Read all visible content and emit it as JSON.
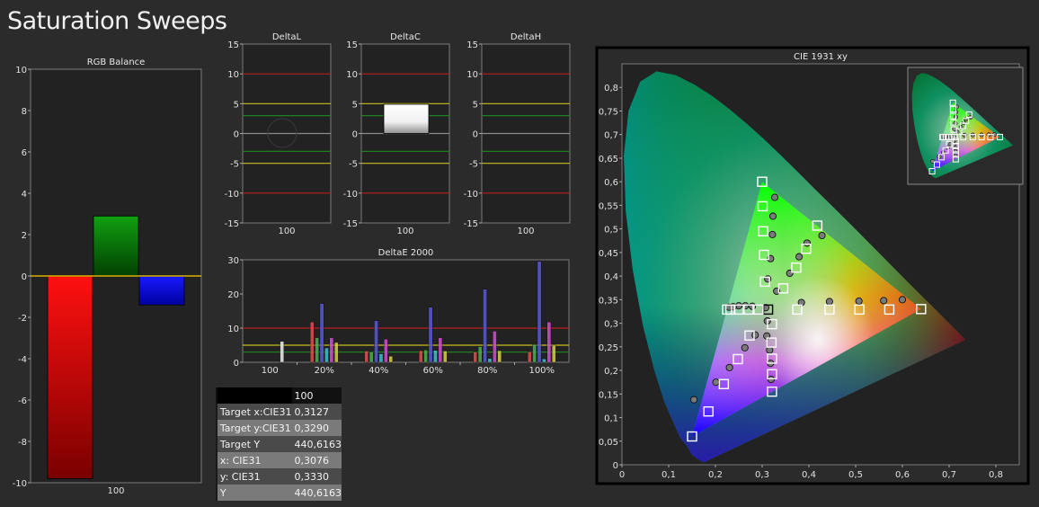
{
  "page_title": "Saturation Sweeps",
  "chart_data": [
    {
      "id": "rgb",
      "type": "bar",
      "title": "RGB Balance",
      "categories": [
        "100"
      ],
      "ylim": [
        -10,
        10
      ],
      "yticks": [
        10,
        8,
        6,
        4,
        2,
        0,
        -2,
        -4,
        -6,
        -8,
        -10
      ],
      "series": [
        {
          "color": "#e00000",
          "values": [
            -9.8
          ]
        },
        {
          "color": "#0a8a0a",
          "values": [
            2.9
          ]
        },
        {
          "color": "#1010f0",
          "values": [
            -1.4
          ]
        }
      ]
    },
    {
      "id": "dl",
      "type": "bar",
      "title": "DeltaL",
      "categories": [
        "100"
      ],
      "ylim": [
        -15,
        15
      ],
      "yticks": [
        15,
        10,
        5,
        0,
        -5,
        -10,
        -15
      ],
      "values": [
        0
      ]
    },
    {
      "id": "dc",
      "type": "bar",
      "title": "DeltaC",
      "categories": [
        "100"
      ],
      "ylim": [
        -15,
        15
      ],
      "yticks": [
        15,
        10,
        5,
        0,
        -5,
        -10,
        -15
      ],
      "values": [
        4.9
      ]
    },
    {
      "id": "dh",
      "type": "bar",
      "title": "DeltaH",
      "categories": [
        "100"
      ],
      "ylim": [
        -15,
        15
      ],
      "yticks": [
        15,
        10,
        5,
        0,
        -5,
        -10,
        -15
      ],
      "values": [
        0
      ]
    },
    {
      "id": "de",
      "type": "bar",
      "title": "DeltaE 2000",
      "categories": [
        "100",
        "20%",
        "40%",
        "60%",
        "80%",
        "100%"
      ],
      "ylim": [
        0,
        30
      ],
      "yticks": [
        30,
        20,
        10,
        0
      ],
      "groups": [
        [
          0,
          0,
          0,
          0,
          0,
          6.1
        ],
        [
          11.8,
          7.2,
          17.2,
          4.2,
          7.2,
          5.8
        ],
        [
          3.3,
          3.0,
          12.2,
          2.5,
          6.8,
          1.8
        ],
        [
          3.4,
          3.6,
          16.1,
          3.5,
          7.2,
          3.3
        ],
        [
          3.0,
          4.6,
          21.4,
          1.1,
          9.1,
          3.4
        ],
        [
          3.1,
          5.2,
          29.5,
          1.0,
          11.8,
          5.0
        ]
      ],
      "colors": [
        "#e05050",
        "#4caf50",
        "#5a5ad8",
        "#40c0d0",
        "#d050d0",
        "#d8d040"
      ]
    },
    {
      "id": "cie",
      "type": "scatter",
      "title": "CIE 1931 xy",
      "xlim": [
        0,
        0.85
      ],
      "ylim": [
        0,
        0.85
      ],
      "xticks": [
        "0",
        "0,1",
        "0,2",
        "0,3",
        "0,4",
        "0,5",
        "0,6",
        "0,7",
        "0,8"
      ],
      "yticks": [
        "0",
        "0,05",
        "0,1",
        "0,15",
        "0,2",
        "0,25",
        "0,3",
        "0,35",
        "0,4",
        "0,45",
        "0,5",
        "0,55",
        "0,6",
        "0,65",
        "0,7",
        "0,75",
        "0,8"
      ],
      "gamut": [
        [
          0.64,
          0.33
        ],
        [
          0.3,
          0.6
        ],
        [
          0.15,
          0.06
        ]
      ],
      "targets": [
        [
          0.3127,
          0.329
        ],
        [
          0.375,
          0.329
        ],
        [
          0.444,
          0.329
        ],
        [
          0.508,
          0.329
        ],
        [
          0.572,
          0.329
        ],
        [
          0.64,
          0.33
        ],
        [
          0.306,
          0.388
        ],
        [
          0.304,
          0.445
        ],
        [
          0.302,
          0.495
        ],
        [
          0.301,
          0.548
        ],
        [
          0.3,
          0.6
        ],
        [
          0.273,
          0.274
        ],
        [
          0.248,
          0.224
        ],
        [
          0.218,
          0.171
        ],
        [
          0.185,
          0.113
        ],
        [
          0.15,
          0.06
        ],
        [
          0.292,
          0.329
        ],
        [
          0.271,
          0.329
        ],
        [
          0.25,
          0.329
        ],
        [
          0.232,
          0.329
        ],
        [
          0.225,
          0.329
        ],
        [
          0.321,
          0.298
        ],
        [
          0.32,
          0.259
        ],
        [
          0.321,
          0.225
        ],
        [
          0.321,
          0.192
        ],
        [
          0.321,
          0.155
        ],
        [
          0.345,
          0.374
        ],
        [
          0.373,
          0.418
        ],
        [
          0.394,
          0.458
        ],
        [
          0.418,
          0.507
        ]
      ],
      "measured": [
        [
          0.3076,
          0.333
        ],
        [
          0.384,
          0.344
        ],
        [
          0.444,
          0.346
        ],
        [
          0.507,
          0.347
        ],
        [
          0.56,
          0.348
        ],
        [
          0.6,
          0.35
        ],
        [
          0.312,
          0.394
        ],
        [
          0.318,
          0.437
        ],
        [
          0.322,
          0.488
        ],
        [
          0.323,
          0.527
        ],
        [
          0.327,
          0.567
        ],
        [
          0.285,
          0.275
        ],
        [
          0.263,
          0.248
        ],
        [
          0.23,
          0.206
        ],
        [
          0.201,
          0.175
        ],
        [
          0.154,
          0.138
        ],
        [
          0.279,
          0.336
        ],
        [
          0.264,
          0.337
        ],
        [
          0.25,
          0.337
        ],
        [
          0.238,
          0.335
        ],
        [
          0.229,
          0.334
        ],
        [
          0.311,
          0.305
        ],
        [
          0.31,
          0.273
        ],
        [
          0.316,
          0.243
        ],
        [
          0.318,
          0.215
        ],
        [
          0.319,
          0.181
        ],
        [
          0.331,
          0.368
        ],
        [
          0.359,
          0.406
        ],
        [
          0.379,
          0.441
        ],
        [
          0.396,
          0.47
        ],
        [
          0.428,
          0.486
        ]
      ]
    }
  ],
  "stats": {
    "header": "100",
    "rows": [
      {
        "label": "Target x:CIE31",
        "value": "0,3127"
      },
      {
        "label": "Target y:CIE31",
        "value": "0,3290"
      },
      {
        "label": "Target Y",
        "value": "440,6163"
      },
      {
        "label": "x: CIE31",
        "value": "0,3076"
      },
      {
        "label": "y: CIE31",
        "value": "0,3330"
      },
      {
        "label": "Y",
        "value": "440,6163"
      }
    ]
  }
}
